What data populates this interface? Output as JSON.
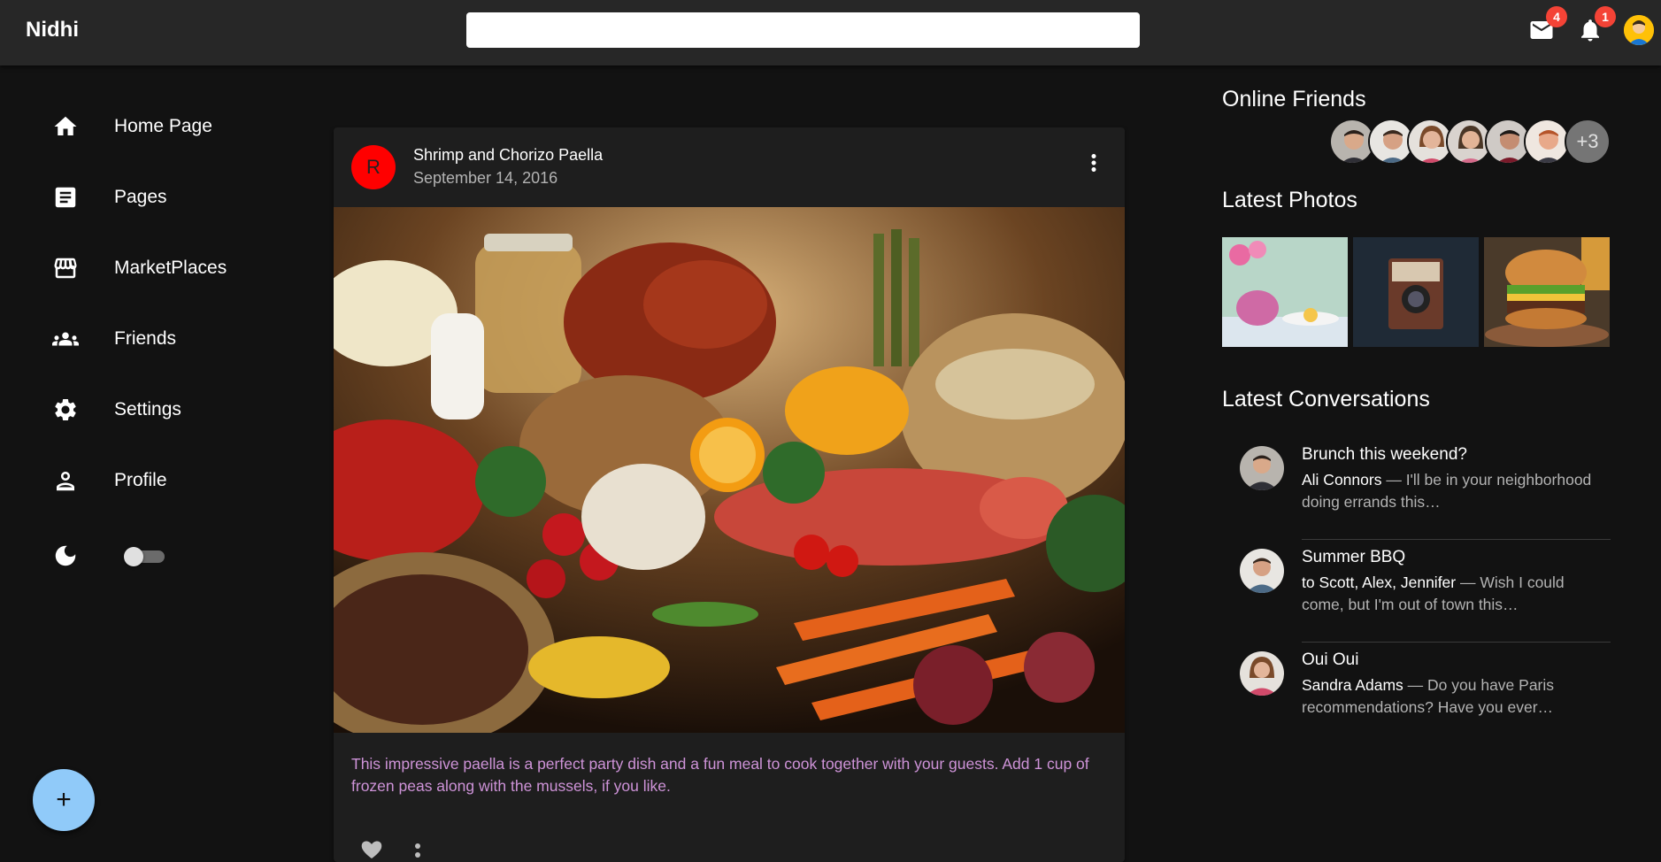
{
  "app": {
    "brand": "Nidhi"
  },
  "search": {
    "placeholder": "",
    "value": ""
  },
  "header": {
    "mail_badge": "4",
    "notifications_badge": "1"
  },
  "nav": {
    "items": [
      {
        "label": "Home Page",
        "icon": "home-icon"
      },
      {
        "label": "Pages",
        "icon": "article-icon"
      },
      {
        "label": "MarketPlaces",
        "icon": "storefront-icon"
      },
      {
        "label": "Friends",
        "icon": "people-icon"
      },
      {
        "label": "Settings",
        "icon": "gear-icon"
      },
      {
        "label": "Profile",
        "icon": "person-icon"
      }
    ],
    "dark_mode": false
  },
  "fab": {
    "label": "+"
  },
  "post": {
    "avatar_letter": "R",
    "title": "Shrimp and Chorizo Paella",
    "date": "September 14, 2016",
    "body": "This impressive paella is a perfect party dish and a fun meal to cook together with your guests. Add 1 cup of frozen peas along with the mussels, if you like."
  },
  "right": {
    "online_title": "Online Friends",
    "online_more": "+3",
    "photos_title": "Latest Photos",
    "conversations_title": "Latest Conversations",
    "conversations": [
      {
        "title": "Brunch this weekend?",
        "from": "Ali Connors",
        "snippet": " — I'll be in your neighborhood doing errands this…"
      },
      {
        "title": "Summer BBQ",
        "from": "to Scott, Alex, Jennifer",
        "snippet": " — Wish I could come, but I'm out of town this…"
      },
      {
        "title": "Oui Oui",
        "from": "Sandra Adams",
        "snippet": " — Do you have Paris recommendations? Have you ever…"
      }
    ]
  },
  "colors": {
    "background": "#121212",
    "appbar": "#272727",
    "card": "#1e1e1e",
    "accent_text": "#ce93d8",
    "fab": "#90caf9",
    "badge": "#f44336"
  }
}
